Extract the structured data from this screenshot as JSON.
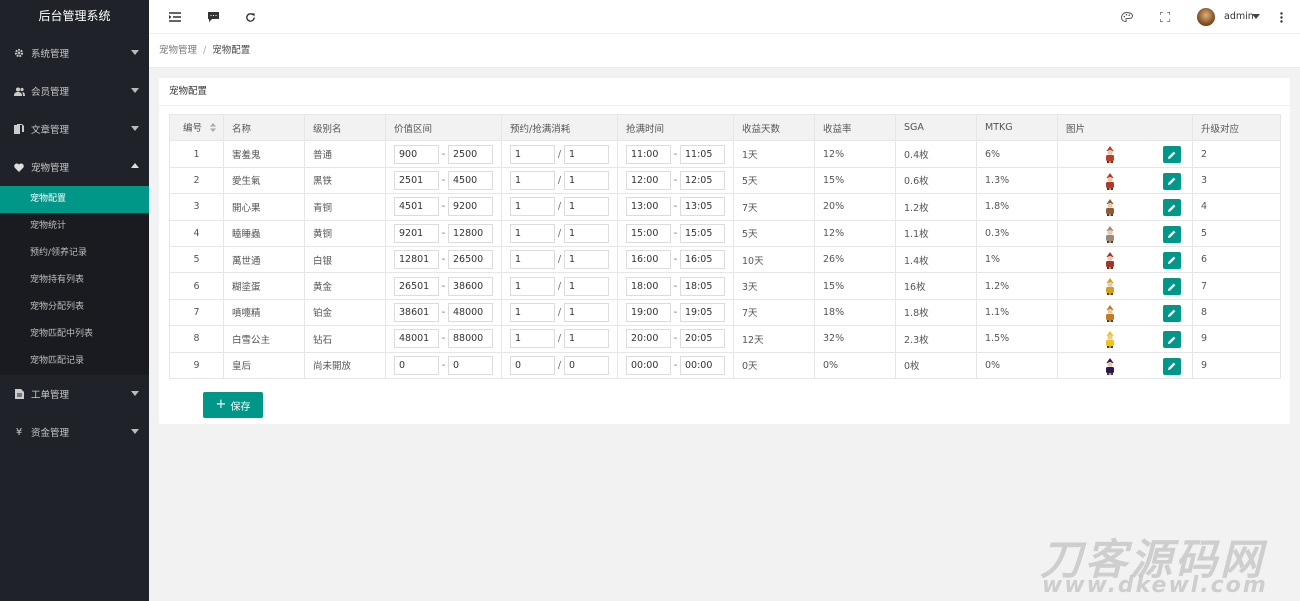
{
  "app_title": "后台管理系统",
  "sidebar": {
    "menus": [
      {
        "label": "系统管理",
        "icon": "gear-icon"
      },
      {
        "label": "会员管理",
        "icon": "users-icon"
      },
      {
        "label": "文章管理",
        "icon": "document-icon"
      },
      {
        "label": "宠物管理",
        "icon": "heart-icon"
      },
      {
        "label": "工单管理",
        "icon": "file-icon"
      },
      {
        "label": "资金管理",
        "icon": "yen-icon",
        "glyph": "¥"
      }
    ],
    "pet_submenu": [
      "宠物配置",
      "宠物统计",
      "预约/领养记录",
      "宠物持有列表",
      "宠物分配列表",
      "宠物匹配中列表",
      "宠物匹配记录"
    ]
  },
  "header": {
    "user": "admin"
  },
  "breadcrumb": {
    "parent": "宠物管理",
    "sep": "/",
    "current": "宠物配置"
  },
  "card": {
    "title": "宠物配置"
  },
  "table": {
    "headers": [
      "编号",
      "名称",
      "级别名",
      "价值区间",
      "预约/抢满消耗",
      "抢满时间",
      "收益天数",
      "收益率",
      "SGA",
      "MTKG",
      "图片",
      "升级对应"
    ],
    "rows": [
      {
        "id": "1",
        "name": "害羞鬼",
        "level": "普通",
        "vmin": "900",
        "vmax": "2500",
        "c1": "1",
        "c2": "1",
        "t1": "11:00",
        "t2": "11:05",
        "days": "1天",
        "rate": "12%",
        "sga": "0.4枚",
        "mtkg": "6%",
        "up": "2",
        "color": "#c0392b"
      },
      {
        "id": "2",
        "name": "愛生氣",
        "level": "黑铁",
        "vmin": "2501",
        "vmax": "4500",
        "c1": "1",
        "c2": "1",
        "t1": "12:00",
        "t2": "12:05",
        "days": "5天",
        "rate": "15%",
        "sga": "0.6枚",
        "mtkg": "1.3%",
        "up": "3",
        "color": "#b03a2e"
      },
      {
        "id": "3",
        "name": "開心果",
        "level": "青铜",
        "vmin": "4501",
        "vmax": "9200",
        "c1": "1",
        "c2": "1",
        "t1": "13:00",
        "t2": "13:05",
        "days": "7天",
        "rate": "20%",
        "sga": "1.2枚",
        "mtkg": "1.8%",
        "up": "4",
        "color": "#8e5b3a"
      },
      {
        "id": "4",
        "name": "瞌睡蟲",
        "level": "黄铜",
        "vmin": "9201",
        "vmax": "12800",
        "c1": "1",
        "c2": "1",
        "t1": "15:00",
        "t2": "15:05",
        "days": "5天",
        "rate": "12%",
        "sga": "1.1枚",
        "mtkg": "0.3%",
        "up": "5",
        "color": "#9a8a7a"
      },
      {
        "id": "5",
        "name": "萬世通",
        "level": "白银",
        "vmin": "12801",
        "vmax": "26500",
        "c1": "1",
        "c2": "1",
        "t1": "16:00",
        "t2": "16:05",
        "days": "10天",
        "rate": "26%",
        "sga": "1.4枚",
        "mtkg": "1%",
        "up": "6",
        "color": "#a93226"
      },
      {
        "id": "6",
        "name": "糊塗蛋",
        "level": "黄金",
        "vmin": "26501",
        "vmax": "38600",
        "c1": "1",
        "c2": "1",
        "t1": "18:00",
        "t2": "18:05",
        "days": "3天",
        "rate": "15%",
        "sga": "16枚",
        "mtkg": "1.2%",
        "up": "7",
        "color": "#d4a017"
      },
      {
        "id": "7",
        "name": "噴嚏精",
        "level": "铂金",
        "vmin": "38601",
        "vmax": "48000",
        "c1": "1",
        "c2": "1",
        "t1": "19:00",
        "t2": "19:05",
        "days": "7天",
        "rate": "18%",
        "sga": "1.8枚",
        "mtkg": "1.1%",
        "up": "8",
        "color": "#c8781e"
      },
      {
        "id": "8",
        "name": "白雪公主",
        "level": "钻石",
        "vmin": "48001",
        "vmax": "88000",
        "c1": "1",
        "c2": "1",
        "t1": "20:00",
        "t2": "20:05",
        "days": "12天",
        "rate": "32%",
        "sga": "2.3枚",
        "mtkg": "1.5%",
        "up": "9",
        "color": "#f1c40f"
      },
      {
        "id": "9",
        "name": "皇后",
        "level": "尚未開放",
        "vmin": "0",
        "vmax": "0",
        "c1": "0",
        "c2": "0",
        "t1": "00:00",
        "t2": "00:00",
        "days": "0天",
        "rate": "0%",
        "sga": "0枚",
        "mtkg": "0%",
        "up": "9",
        "color": "#2c1a4d"
      }
    ]
  },
  "save_label": "保存",
  "watermark": {
    "line1": "刀客源码网",
    "line2": "www.dkewl.com"
  },
  "colors": {
    "accent": "#009688",
    "sidebar": "#20222a"
  }
}
